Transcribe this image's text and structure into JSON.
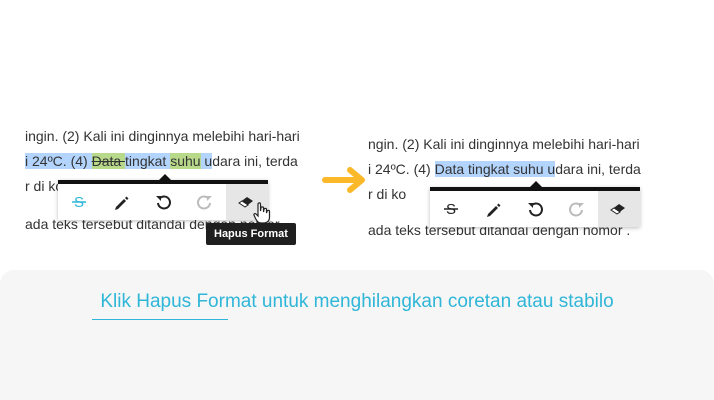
{
  "left_panel": {
    "line1": "ingin. (2) Kali ini dinginnya melebihi hari-hari",
    "line2_a": "i 24ºC. (4) ",
    "line2_strike": "Data ",
    "line2_b": "tingkat ",
    "line2_green": "suhu",
    "line2_c": " u",
    "line2_d": "dara ini, terda",
    "line3": "r di ko",
    "line4": "ada teks tersebut ditandai dengan nomor .",
    "tooltip": "Hapus Format"
  },
  "right_panel": {
    "line1": "ngin. (2) Kali ini dinginnya melebihi hari-hari",
    "line2_a": "i 24ºC. (4) ",
    "line2_sel": "Data tingkat suhu u",
    "line2_b": "dara ini, terda",
    "line3": "r di ko",
    "line4": "ada teks tersebut ditandai dengan nomor ."
  },
  "toolbar_icons": [
    "strikethrough-icon",
    "pencil-icon",
    "undo-icon",
    "redo-icon",
    "eraser-icon"
  ],
  "caption": {
    "pre": "Klik ",
    "link": "Hapus Format",
    "post": " untuk menghilangkan coretan atau stabilo"
  },
  "colors": {
    "accent": "#2fb6d8",
    "arrow": "#fbb829",
    "highlight_green": "#b8d98a",
    "selection": "#b3d4fc",
    "toolbar_bar": "#111111"
  }
}
